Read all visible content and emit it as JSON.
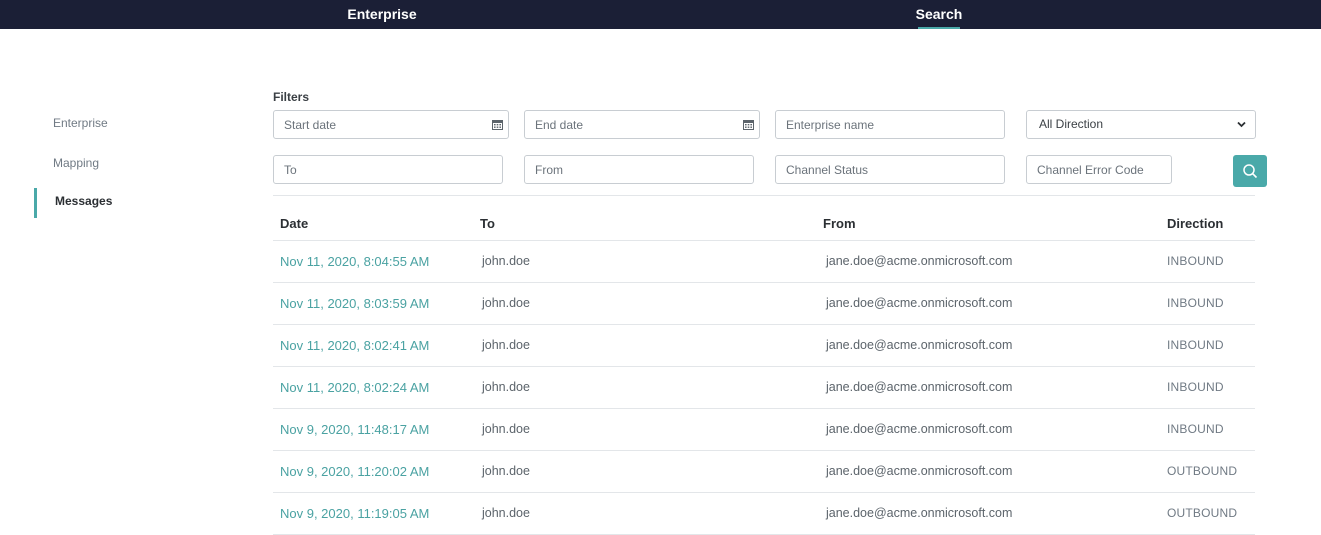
{
  "nav": {
    "tabs": [
      {
        "label": "Enterprise"
      },
      {
        "label": "Search"
      }
    ]
  },
  "sidebar": {
    "items": [
      {
        "label": "Enterprise"
      },
      {
        "label": "Mapping"
      },
      {
        "label": "Messages"
      }
    ]
  },
  "filters": {
    "label": "Filters",
    "start_date": {
      "placeholder": "Start date"
    },
    "end_date": {
      "placeholder": "End date"
    },
    "enterprise_name": {
      "placeholder": "Enterprise name"
    },
    "direction": {
      "selected": "All Direction"
    },
    "to": {
      "placeholder": "To"
    },
    "from": {
      "placeholder": "From"
    },
    "channel_status": {
      "placeholder": "Channel Status"
    },
    "channel_error_code": {
      "placeholder": "Channel Error Code"
    }
  },
  "table": {
    "headers": {
      "date": "Date",
      "to": "To",
      "from": "From",
      "direction": "Direction"
    },
    "rows": [
      {
        "date": "Nov 11, 2020, 8:04:55 AM",
        "to": "john.doe",
        "from": "jane.doe@acme.onmicrosoft.com",
        "direction": "INBOUND"
      },
      {
        "date": "Nov 11, 2020, 8:03:59 AM",
        "to": "john.doe",
        "from": "jane.doe@acme.onmicrosoft.com",
        "direction": "INBOUND"
      },
      {
        "date": "Nov 11, 2020, 8:02:41 AM",
        "to": "john.doe",
        "from": "jane.doe@acme.onmicrosoft.com",
        "direction": "INBOUND"
      },
      {
        "date": "Nov 11, 2020, 8:02:24 AM",
        "to": "john.doe",
        "from": "jane.doe@acme.onmicrosoft.com",
        "direction": "INBOUND"
      },
      {
        "date": "Nov 9, 2020, 11:48:17 AM",
        "to": "john.doe",
        "from": "jane.doe@acme.onmicrosoft.com",
        "direction": "INBOUND"
      },
      {
        "date": "Nov 9, 2020, 11:20:02 AM",
        "to": "john.doe",
        "from": "jane.doe@acme.onmicrosoft.com",
        "direction": "OUTBOUND"
      },
      {
        "date": "Nov 9, 2020, 11:19:05 AM",
        "to": "john.doe",
        "from": "jane.doe@acme.onmicrosoft.com",
        "direction": "OUTBOUND"
      }
    ]
  },
  "colors": {
    "nav_bg": "#1b1f36",
    "accent": "#4aa9a9",
    "link": "#4aa2a2"
  },
  "icons": {
    "calendar": "calendar-icon",
    "chevron": "chevron-down-icon",
    "search": "search-icon"
  }
}
